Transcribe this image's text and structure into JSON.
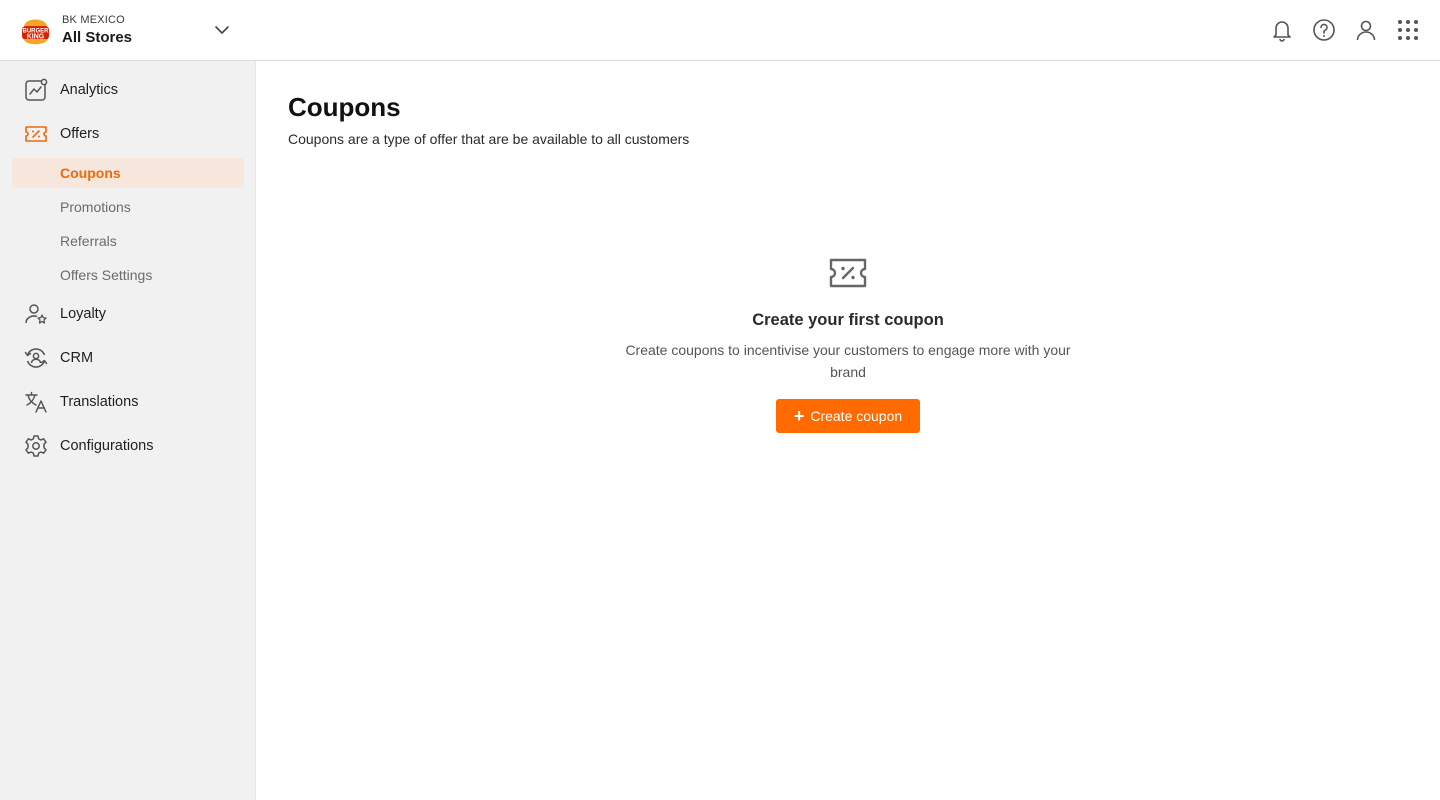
{
  "brand": {
    "logo_text": "BURGER KING",
    "org": "BK MEXICO",
    "store": "All Stores"
  },
  "top_icons": [
    "bell-icon",
    "help-icon",
    "user-icon",
    "apps-grid-icon"
  ],
  "sidebar": {
    "items": [
      {
        "label": "Analytics",
        "icon": "analytics-icon"
      },
      {
        "label": "Offers",
        "icon": "ticket-icon"
      },
      {
        "label": "Loyalty",
        "icon": "user-star-icon"
      },
      {
        "label": "CRM",
        "icon": "refresh-user-icon"
      },
      {
        "label": "Translations",
        "icon": "translate-icon"
      },
      {
        "label": "Configurations",
        "icon": "gear-icon"
      }
    ],
    "offers_subitems": [
      {
        "label": "Coupons",
        "active": true
      },
      {
        "label": "Promotions",
        "active": false
      },
      {
        "label": "Referrals",
        "active": false
      },
      {
        "label": "Offers Settings",
        "active": false
      }
    ]
  },
  "main": {
    "title": "Coupons",
    "subtitle": "Coupons are a type of offer that are be available to all customers",
    "empty_state": {
      "icon": "ticket-icon",
      "title": "Create your first coupon",
      "description": "Create coupons to incentivise your customers to engage more with your brand",
      "button_label": "Create coupon"
    }
  },
  "colors": {
    "accent": "#ff6b00",
    "active_bg": "#f7e6dc",
    "active_text": "#ec6a0c",
    "sidebar_bg": "#f1f1f1"
  }
}
